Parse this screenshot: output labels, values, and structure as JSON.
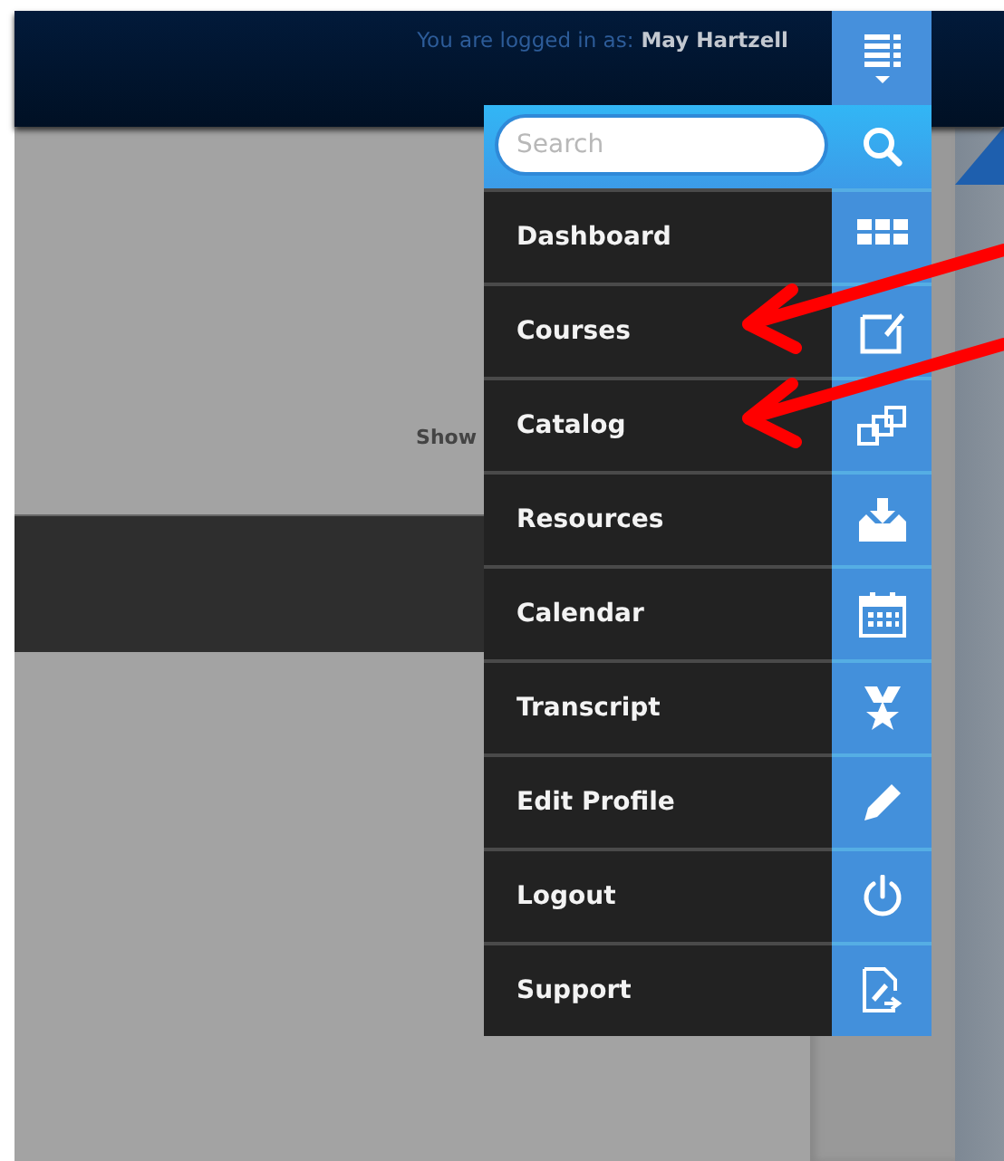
{
  "header": {
    "login_label": "You are logged in as:",
    "user_name": "May Hartzell"
  },
  "content": {
    "label": "Show"
  },
  "menu": {
    "search": {
      "placeholder": "Search"
    },
    "items": [
      {
        "label": "Dashboard",
        "kind": "grid",
        "annotated": false
      },
      {
        "label": "Courses",
        "kind": "window",
        "annotated": true
      },
      {
        "label": "Catalog",
        "kind": "windows",
        "annotated": true
      },
      {
        "label": "Resources",
        "kind": "inbox",
        "annotated": false
      },
      {
        "label": "Calendar",
        "kind": "calendar",
        "annotated": false
      },
      {
        "label": "Transcript",
        "kind": "award",
        "annotated": false
      },
      {
        "label": "Edit Profile",
        "kind": "pencil",
        "annotated": false
      },
      {
        "label": "Logout",
        "kind": "power",
        "annotated": false
      },
      {
        "label": "Support",
        "kind": "document",
        "annotated": false
      }
    ]
  }
}
